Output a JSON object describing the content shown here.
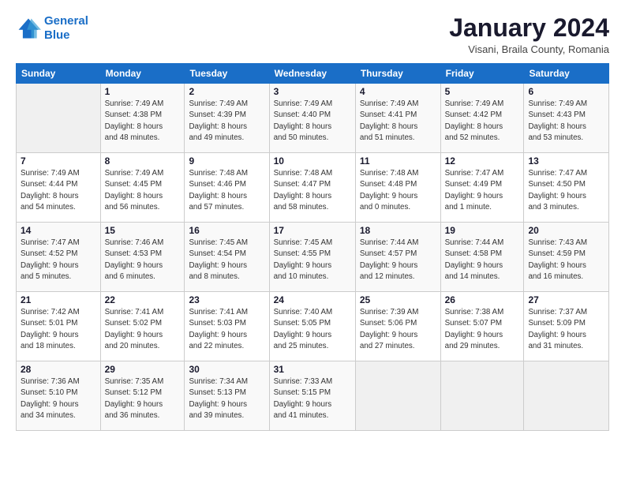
{
  "logo": {
    "line1": "General",
    "line2": "Blue"
  },
  "title": "January 2024",
  "subtitle": "Visani, Braila County, Romania",
  "weekdays": [
    "Sunday",
    "Monday",
    "Tuesday",
    "Wednesday",
    "Thursday",
    "Friday",
    "Saturday"
  ],
  "weeks": [
    [
      {
        "day": "",
        "info": ""
      },
      {
        "day": "1",
        "info": "Sunrise: 7:49 AM\nSunset: 4:38 PM\nDaylight: 8 hours\nand 48 minutes."
      },
      {
        "day": "2",
        "info": "Sunrise: 7:49 AM\nSunset: 4:39 PM\nDaylight: 8 hours\nand 49 minutes."
      },
      {
        "day": "3",
        "info": "Sunrise: 7:49 AM\nSunset: 4:40 PM\nDaylight: 8 hours\nand 50 minutes."
      },
      {
        "day": "4",
        "info": "Sunrise: 7:49 AM\nSunset: 4:41 PM\nDaylight: 8 hours\nand 51 minutes."
      },
      {
        "day": "5",
        "info": "Sunrise: 7:49 AM\nSunset: 4:42 PM\nDaylight: 8 hours\nand 52 minutes."
      },
      {
        "day": "6",
        "info": "Sunrise: 7:49 AM\nSunset: 4:43 PM\nDaylight: 8 hours\nand 53 minutes."
      }
    ],
    [
      {
        "day": "7",
        "info": "Sunrise: 7:49 AM\nSunset: 4:44 PM\nDaylight: 8 hours\nand 54 minutes."
      },
      {
        "day": "8",
        "info": "Sunrise: 7:49 AM\nSunset: 4:45 PM\nDaylight: 8 hours\nand 56 minutes."
      },
      {
        "day": "9",
        "info": "Sunrise: 7:48 AM\nSunset: 4:46 PM\nDaylight: 8 hours\nand 57 minutes."
      },
      {
        "day": "10",
        "info": "Sunrise: 7:48 AM\nSunset: 4:47 PM\nDaylight: 8 hours\nand 58 minutes."
      },
      {
        "day": "11",
        "info": "Sunrise: 7:48 AM\nSunset: 4:48 PM\nDaylight: 9 hours\nand 0 minutes."
      },
      {
        "day": "12",
        "info": "Sunrise: 7:47 AM\nSunset: 4:49 PM\nDaylight: 9 hours\nand 1 minute."
      },
      {
        "day": "13",
        "info": "Sunrise: 7:47 AM\nSunset: 4:50 PM\nDaylight: 9 hours\nand 3 minutes."
      }
    ],
    [
      {
        "day": "14",
        "info": "Sunrise: 7:47 AM\nSunset: 4:52 PM\nDaylight: 9 hours\nand 5 minutes."
      },
      {
        "day": "15",
        "info": "Sunrise: 7:46 AM\nSunset: 4:53 PM\nDaylight: 9 hours\nand 6 minutes."
      },
      {
        "day": "16",
        "info": "Sunrise: 7:45 AM\nSunset: 4:54 PM\nDaylight: 9 hours\nand 8 minutes."
      },
      {
        "day": "17",
        "info": "Sunrise: 7:45 AM\nSunset: 4:55 PM\nDaylight: 9 hours\nand 10 minutes."
      },
      {
        "day": "18",
        "info": "Sunrise: 7:44 AM\nSunset: 4:57 PM\nDaylight: 9 hours\nand 12 minutes."
      },
      {
        "day": "19",
        "info": "Sunrise: 7:44 AM\nSunset: 4:58 PM\nDaylight: 9 hours\nand 14 minutes."
      },
      {
        "day": "20",
        "info": "Sunrise: 7:43 AM\nSunset: 4:59 PM\nDaylight: 9 hours\nand 16 minutes."
      }
    ],
    [
      {
        "day": "21",
        "info": "Sunrise: 7:42 AM\nSunset: 5:01 PM\nDaylight: 9 hours\nand 18 minutes."
      },
      {
        "day": "22",
        "info": "Sunrise: 7:41 AM\nSunset: 5:02 PM\nDaylight: 9 hours\nand 20 minutes."
      },
      {
        "day": "23",
        "info": "Sunrise: 7:41 AM\nSunset: 5:03 PM\nDaylight: 9 hours\nand 22 minutes."
      },
      {
        "day": "24",
        "info": "Sunrise: 7:40 AM\nSunset: 5:05 PM\nDaylight: 9 hours\nand 25 minutes."
      },
      {
        "day": "25",
        "info": "Sunrise: 7:39 AM\nSunset: 5:06 PM\nDaylight: 9 hours\nand 27 minutes."
      },
      {
        "day": "26",
        "info": "Sunrise: 7:38 AM\nSunset: 5:07 PM\nDaylight: 9 hours\nand 29 minutes."
      },
      {
        "day": "27",
        "info": "Sunrise: 7:37 AM\nSunset: 5:09 PM\nDaylight: 9 hours\nand 31 minutes."
      }
    ],
    [
      {
        "day": "28",
        "info": "Sunrise: 7:36 AM\nSunset: 5:10 PM\nDaylight: 9 hours\nand 34 minutes."
      },
      {
        "day": "29",
        "info": "Sunrise: 7:35 AM\nSunset: 5:12 PM\nDaylight: 9 hours\nand 36 minutes."
      },
      {
        "day": "30",
        "info": "Sunrise: 7:34 AM\nSunset: 5:13 PM\nDaylight: 9 hours\nand 39 minutes."
      },
      {
        "day": "31",
        "info": "Sunrise: 7:33 AM\nSunset: 5:15 PM\nDaylight: 9 hours\nand 41 minutes."
      },
      {
        "day": "",
        "info": ""
      },
      {
        "day": "",
        "info": ""
      },
      {
        "day": "",
        "info": ""
      }
    ]
  ]
}
